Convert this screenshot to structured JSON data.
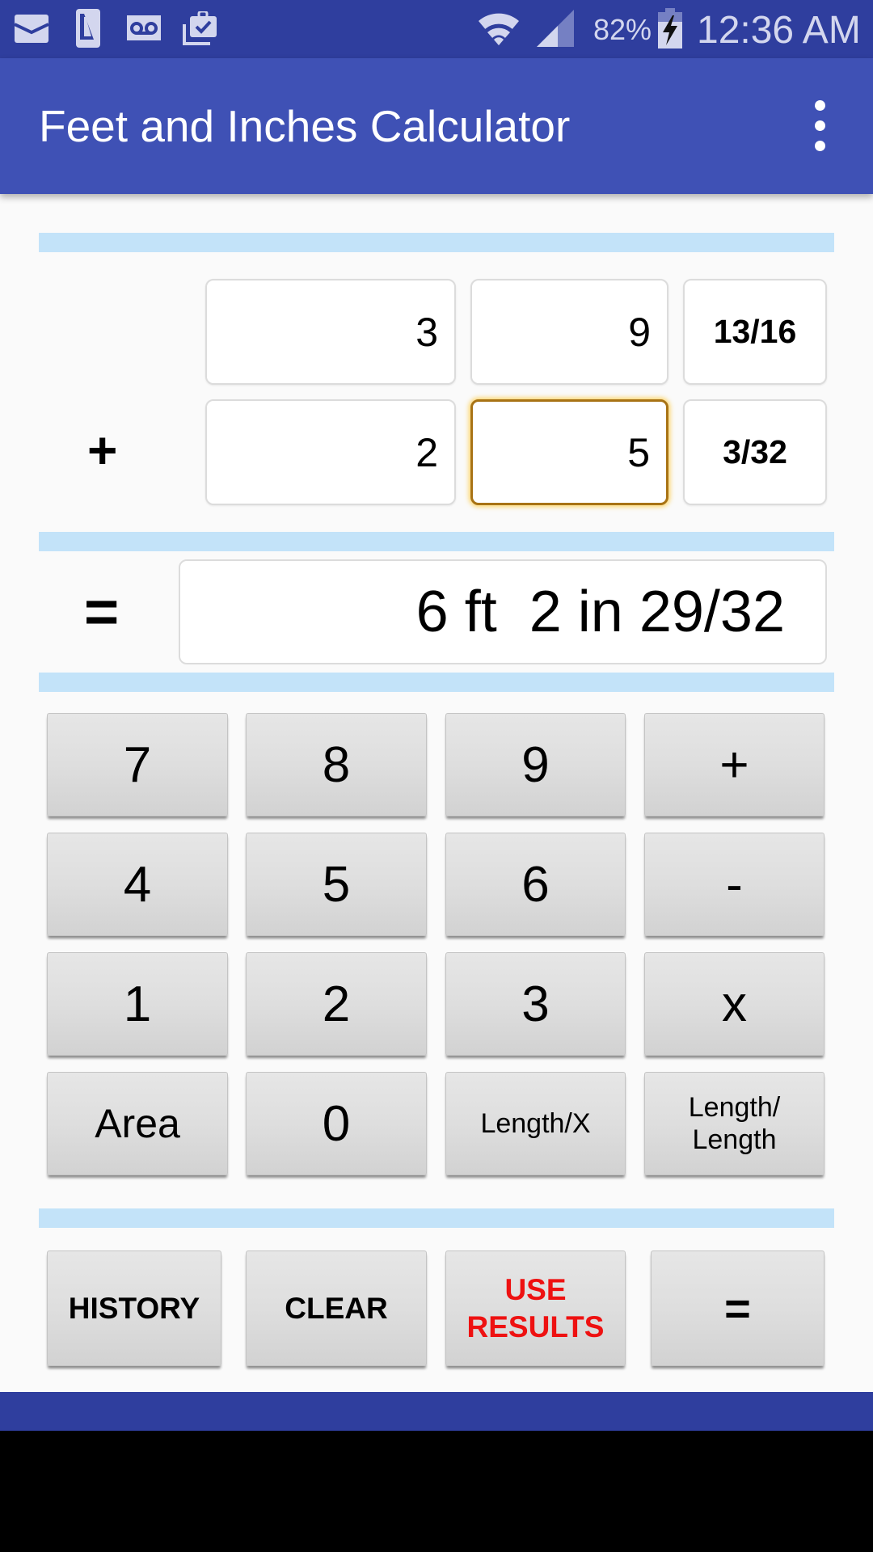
{
  "status_bar": {
    "left_icons": [
      "mail-icon",
      "phone-icon",
      "voicemail-icon",
      "clipboard-check-icon"
    ],
    "right_icons": [
      "wifi-icon",
      "cell-signal-icon",
      "battery-charging-icon"
    ],
    "battery_percent": "82%",
    "time": "12:36 AM"
  },
  "app_bar": {
    "title": "Feet and Inches Calculator",
    "overflow_icon": "more-vert-icon"
  },
  "inputs": {
    "row1": {
      "operator": "",
      "feet": "3",
      "inches": "9",
      "fraction": "13/16"
    },
    "row2": {
      "operator": "+",
      "feet": "2",
      "inches": "5",
      "fraction": "3/32",
      "focused_field": "inches"
    }
  },
  "result": {
    "equals_label": "=",
    "value": "6 ft  2 in 29/32"
  },
  "keypad": {
    "rows": [
      [
        "7",
        "8",
        "9",
        "+"
      ],
      [
        "4",
        "5",
        "6",
        "-"
      ],
      [
        "1",
        "2",
        "3",
        "x"
      ],
      [
        "Area",
        "0",
        "Length/X",
        "Length/\nLength"
      ]
    ]
  },
  "actions": {
    "history": "HISTORY",
    "clear": "CLEAR",
    "use_results_line1": "USE",
    "use_results_line2": "RESULTS",
    "equals": "="
  },
  "colors": {
    "status_bar": "#2f3e9e",
    "app_bar": "#3f51b5",
    "divider": "#c3e3f9",
    "focus_border": "#a87315",
    "use_results_text": "#ee1111"
  }
}
